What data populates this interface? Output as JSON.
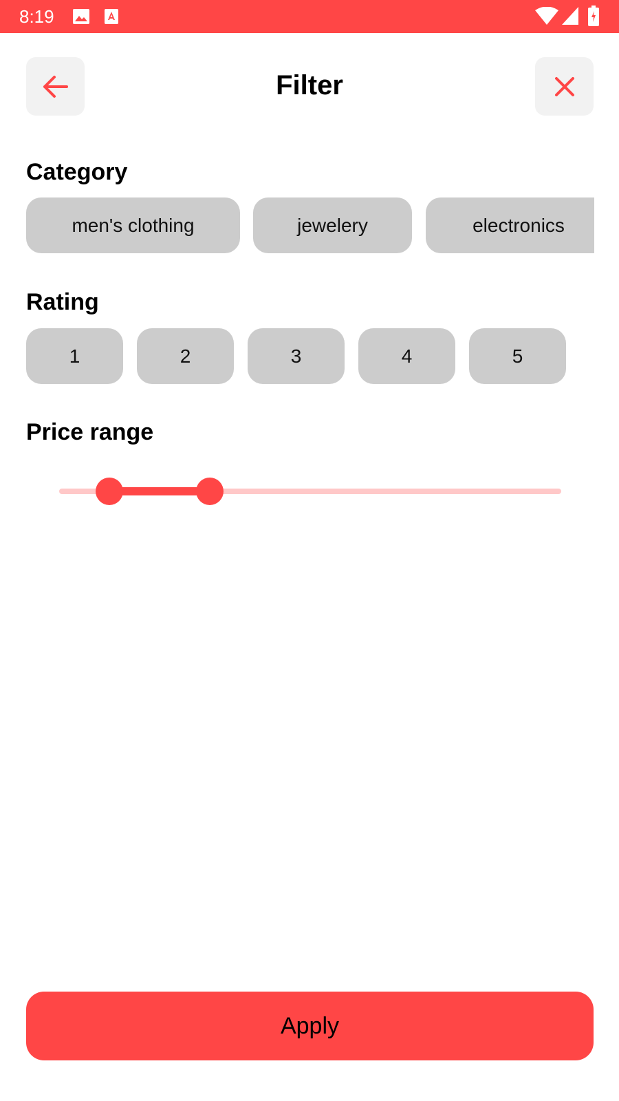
{
  "status_bar": {
    "time": "8:19",
    "icons": [
      "image-icon",
      "font-icon",
      "wifi-icon",
      "signal-icon",
      "battery-icon"
    ]
  },
  "header": {
    "title": "Filter",
    "back_icon": "arrow-left-icon",
    "close_icon": "close-icon"
  },
  "category": {
    "title": "Category",
    "options": [
      "men's clothing",
      "jewelery",
      "electronics"
    ]
  },
  "rating": {
    "title": "Rating",
    "options": [
      "1",
      "2",
      "3",
      "4",
      "5"
    ]
  },
  "price_range": {
    "title": "Price range",
    "lower_fraction": 0.1,
    "upper_fraction": 0.3
  },
  "apply_button": {
    "label": "Apply"
  },
  "colors": {
    "accent": "#ff4646",
    "accent_light": "#ffc8c8",
    "chip_bg": "#cccccc",
    "header_button_bg": "#f2f2f2"
  }
}
